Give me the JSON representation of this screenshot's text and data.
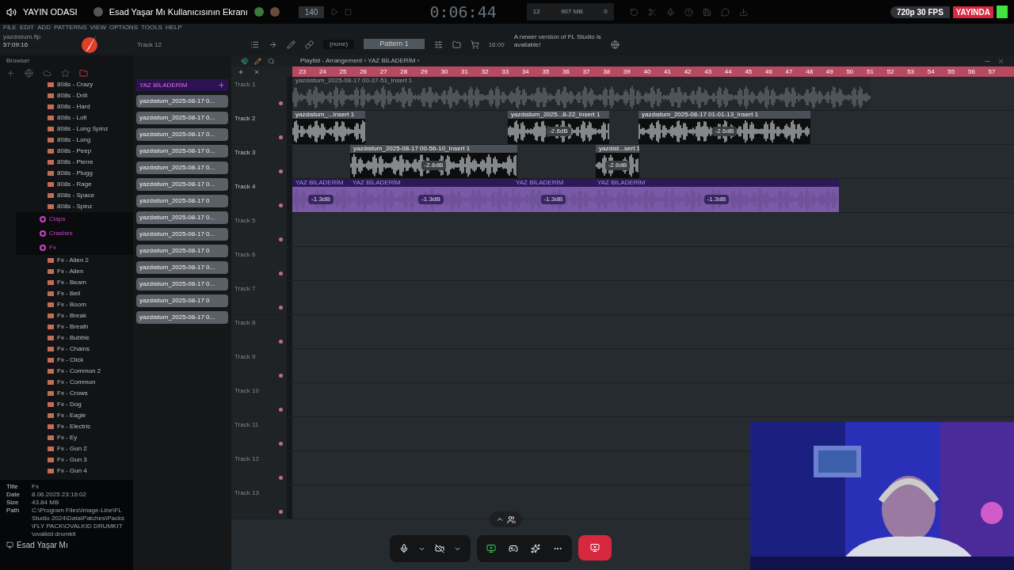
{
  "call_header": {
    "channel": "YAYIN ODASI",
    "title": "Esad Yaşar Mı Kullanıcısının Ekranı",
    "quality": "720p 30 FPS",
    "live": "YAYINDA"
  },
  "menu": [
    "FILE",
    "EDIT",
    "ADD",
    "PATTERNS",
    "VIEW",
    "OPTIONS",
    "TOOLS",
    "HELP"
  ],
  "transport": {
    "tempo": "140",
    "time": "0:06:44",
    "cpu": "12",
    "memory": "907 MB",
    "voices": "0"
  },
  "project": {
    "file": "yazdıstum.flp",
    "time": "57:09:16",
    "hint": "Track 12"
  },
  "pattern_selector": {
    "channel": "(none)",
    "pattern": "Pattern 1"
  },
  "notice": {
    "time": "16:00",
    "text": "A newer version of FL Studio is available!"
  },
  "browser": {
    "title": "Browser",
    "items": [
      {
        "kind": "folder",
        "label": "808s - Crazy"
      },
      {
        "kind": "folder",
        "label": "808s - Drill"
      },
      {
        "kind": "folder",
        "label": "808s - Hard"
      },
      {
        "kind": "folder",
        "label": "808s - Lofi"
      },
      {
        "kind": "folder",
        "label": "808s - Long Spinz"
      },
      {
        "kind": "folder",
        "label": "808s - Long"
      },
      {
        "kind": "folder",
        "label": "808s - Peep"
      },
      {
        "kind": "folder",
        "label": "808s - Pierre"
      },
      {
        "kind": "folder",
        "label": "808s - Plugg"
      },
      {
        "kind": "folder",
        "label": "808s - Rage"
      },
      {
        "kind": "folder",
        "label": "808s - Space"
      },
      {
        "kind": "folder",
        "label": "808s - Spinz"
      },
      {
        "kind": "category",
        "label": "Claps"
      },
      {
        "kind": "category",
        "label": "Crashes"
      },
      {
        "kind": "category",
        "label": "Fx"
      },
      {
        "kind": "folder",
        "label": "Fx - Alien 2"
      },
      {
        "kind": "folder",
        "label": "Fx - Alien"
      },
      {
        "kind": "folder",
        "label": "Fx - Beam"
      },
      {
        "kind": "folder",
        "label": "Fx - Bell"
      },
      {
        "kind": "folder",
        "label": "Fx - Boom"
      },
      {
        "kind": "folder",
        "label": "Fx - Break"
      },
      {
        "kind": "folder",
        "label": "Fx - Breath"
      },
      {
        "kind": "folder",
        "label": "Fx - Bubble"
      },
      {
        "kind": "folder",
        "label": "Fx - Chains"
      },
      {
        "kind": "folder",
        "label": "Fx - Click"
      },
      {
        "kind": "folder",
        "label": "Fx - Common 2"
      },
      {
        "kind": "folder",
        "label": "Fx - Common"
      },
      {
        "kind": "folder",
        "label": "Fx - Crows"
      },
      {
        "kind": "folder",
        "label": "Fx - Dog"
      },
      {
        "kind": "folder",
        "label": "Fx - Eagle"
      },
      {
        "kind": "folder",
        "label": "Fx - Electric"
      },
      {
        "kind": "folder",
        "label": "Fx - Ey"
      },
      {
        "kind": "folder",
        "label": "Fx - Gun 2"
      },
      {
        "kind": "folder",
        "label": "Fx - Gun 3"
      },
      {
        "kind": "folder",
        "label": "Fx - Gun 4"
      }
    ]
  },
  "file_info": [
    {
      "label": "Title",
      "value": "Fx"
    },
    {
      "label": "Date",
      "value": "8.06.2025 23:16:02"
    },
    {
      "label": "Size",
      "value": "43.84 MB"
    },
    {
      "label": "Path",
      "value": "C:\\Program Files\\Image-Line\\FL Studio 2024\\Data\\Patches\\Packs\\FLY PACK\\OVALKID DRUMKIT\\ovalkid drumkit"
    }
  ],
  "pattern_list": {
    "title": "YAZ BİLADERİM",
    "items": [
      "yazdıstum_2025-08-17 0...",
      "yazdıstum_2025-08-17 0...",
      "yazdıstum_2025-08-17 0...",
      "yazdıstum_2025-08-17 0...",
      "yazdıstum_2025-08-17 0...",
      "yazdıstum_2025-08-17 0...",
      "yazdıstum_2025-08-17 0",
      "yazdıstum_2025-08-17 0...",
      "yazdıstum_2025-08-17 0...",
      "yazdıstum_2025-08-17 0",
      "yazdıstum_2025-08-17 0...",
      "yazdıstum_2025-08-17 0...",
      "yazdıstum_2025-08-17 0",
      "yazdıstum_2025-08-17 0..."
    ]
  },
  "playlist": {
    "title": "Playlist - Arrangement › YAZ BİLADERİM ›",
    "bars": [
      "23",
      "24",
      "25",
      "26",
      "27",
      "28",
      "29",
      "30",
      "31",
      "32",
      "33",
      "34",
      "35",
      "36",
      "37",
      "38",
      "39",
      "40",
      "41",
      "42",
      "43",
      "44",
      "45",
      "46",
      "47",
      "48",
      "49",
      "50",
      "51",
      "52",
      "53",
      "54",
      "55",
      "56",
      "57"
    ],
    "tracks": [
      {
        "name": "Track 1",
        "clips": [
          {
            "kind": "audio",
            "label": "yazdıstum_2025-08-17 00-37-51_Insert 1"
          }
        ]
      },
      {
        "name": "Track 2",
        "clips": [
          {
            "kind": "audio",
            "label": "yazdıstum_...Insert 1"
          },
          {
            "kind": "audio",
            "label": "yazdıstum_2025...8-22_Insert 1",
            "gain": "-2.6dB"
          },
          {
            "kind": "audio",
            "label": "yazdıstum_2025-08-17 01-01-13_Insert 1",
            "gain": "-2.6dB"
          }
        ]
      },
      {
        "name": "Track 3",
        "clips": [
          {
            "kind": "audio",
            "label": "yazdıstum_2025-08-17 00-56-10_Insert 1",
            "gain": "-2.6dB"
          },
          {
            "kind": "audio",
            "label": "yazdıst...sert 1",
            "gain": "-2.6dB"
          }
        ]
      },
      {
        "name": "Track 4",
        "clips": [
          {
            "kind": "pattern",
            "label": "YAZ BİLADERİM",
            "gain": "-1.3dB"
          },
          {
            "kind": "pattern",
            "label": "YAZ BİLADERİM",
            "gain": "-1.3dB"
          },
          {
            "kind": "pattern",
            "label": "YAZ BİLADERİM",
            "gain": "-1.3dB"
          },
          {
            "kind": "pattern",
            "label": "YAZ BİLADERİM",
            "gain": "-1.3dB"
          }
        ]
      },
      {
        "name": "Track 5"
      },
      {
        "name": "Track 6"
      },
      {
        "name": "Track 7"
      },
      {
        "name": "Track 8"
      },
      {
        "name": "Track 9"
      },
      {
        "name": "Track 10"
      },
      {
        "name": "Track 11"
      },
      {
        "name": "Track 12"
      },
      {
        "name": "Track 13"
      }
    ]
  },
  "user": {
    "name": "Esad Yaşar Mı"
  }
}
